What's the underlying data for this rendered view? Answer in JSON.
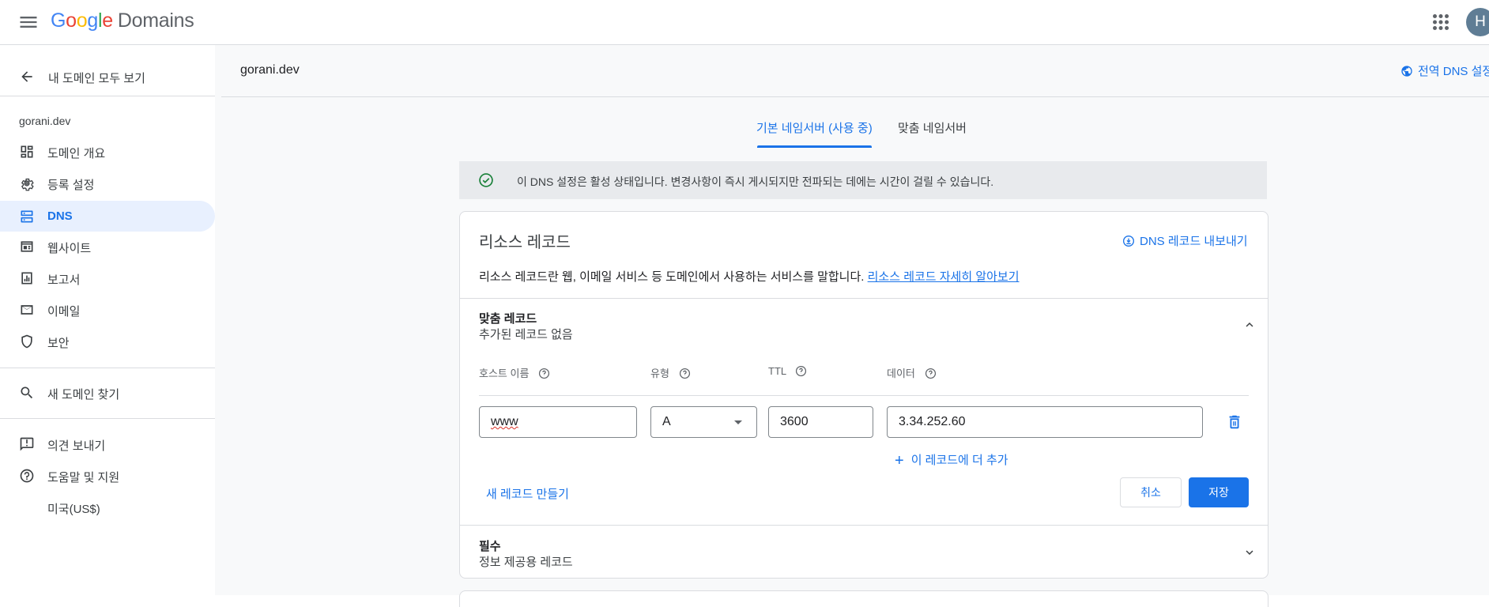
{
  "header": {
    "logo_letters": [
      "G",
      "o",
      "o",
      "g",
      "l",
      "e"
    ],
    "product": "Domains",
    "avatar_initial": "H"
  },
  "sidebar": {
    "back_label": "내 도메인 모두 보기",
    "domain": "gorani.dev",
    "items": [
      {
        "label": "도메인 개요",
        "icon": "dashboard-icon"
      },
      {
        "label": "등록 설정",
        "icon": "gear-icon"
      },
      {
        "label": "DNS",
        "icon": "dns-icon",
        "active": true
      },
      {
        "label": "웹사이트",
        "icon": "website-icon"
      },
      {
        "label": "보고서",
        "icon": "report-icon"
      },
      {
        "label": "이메일",
        "icon": "mail-icon"
      },
      {
        "label": "보안",
        "icon": "shield-icon"
      }
    ],
    "find_domain": "새 도메인 찾기",
    "feedback": "의견 보내기",
    "help": "도움말 및 지원",
    "locale": "미국(US$)"
  },
  "main": {
    "domain_title": "gorani.dev",
    "global_dns_link": "전역 DNS 설정",
    "tabs": [
      {
        "label": "기본 네임서버 (사용 중)",
        "active": true
      },
      {
        "label": "맞춤 네임서버",
        "active": false
      }
    ],
    "banner_text": "이 DNS 설정은 활성 상태입니다. 변경사항이 즉시 게시되지만 전파되는 데에는 시간이 걸릴 수 있습니다."
  },
  "resource_records": {
    "title": "리소스 레코드",
    "export_link": "DNS 레코드 내보내기",
    "description": "리소스 레코드란 웹, 이메일 서비스 등 도메인에서 사용하는 서비스를 말합니다.",
    "learn_more": "리소스 레코드 자세히 알아보기",
    "custom_records": {
      "title": "맞춤 레코드",
      "subtitle": "추가된 레코드 없음",
      "columns": {
        "host": "호스트 이름",
        "type": "유형",
        "ttl": "TTL",
        "data": "데이터"
      },
      "row": {
        "host": "www",
        "type": "A",
        "ttl": "3600",
        "data": "3.34.252.60"
      },
      "add_more": "이 레코드에 더 추가",
      "new_record": "새 레코드 만들기",
      "cancel": "취소",
      "save": "저장"
    },
    "required": {
      "title": "필수",
      "subtitle": "정보 제공용 레코드"
    }
  },
  "colors": {
    "accent": "#1a73e8",
    "active_nav_bg": "#e8f0fe",
    "success": "#188038"
  }
}
